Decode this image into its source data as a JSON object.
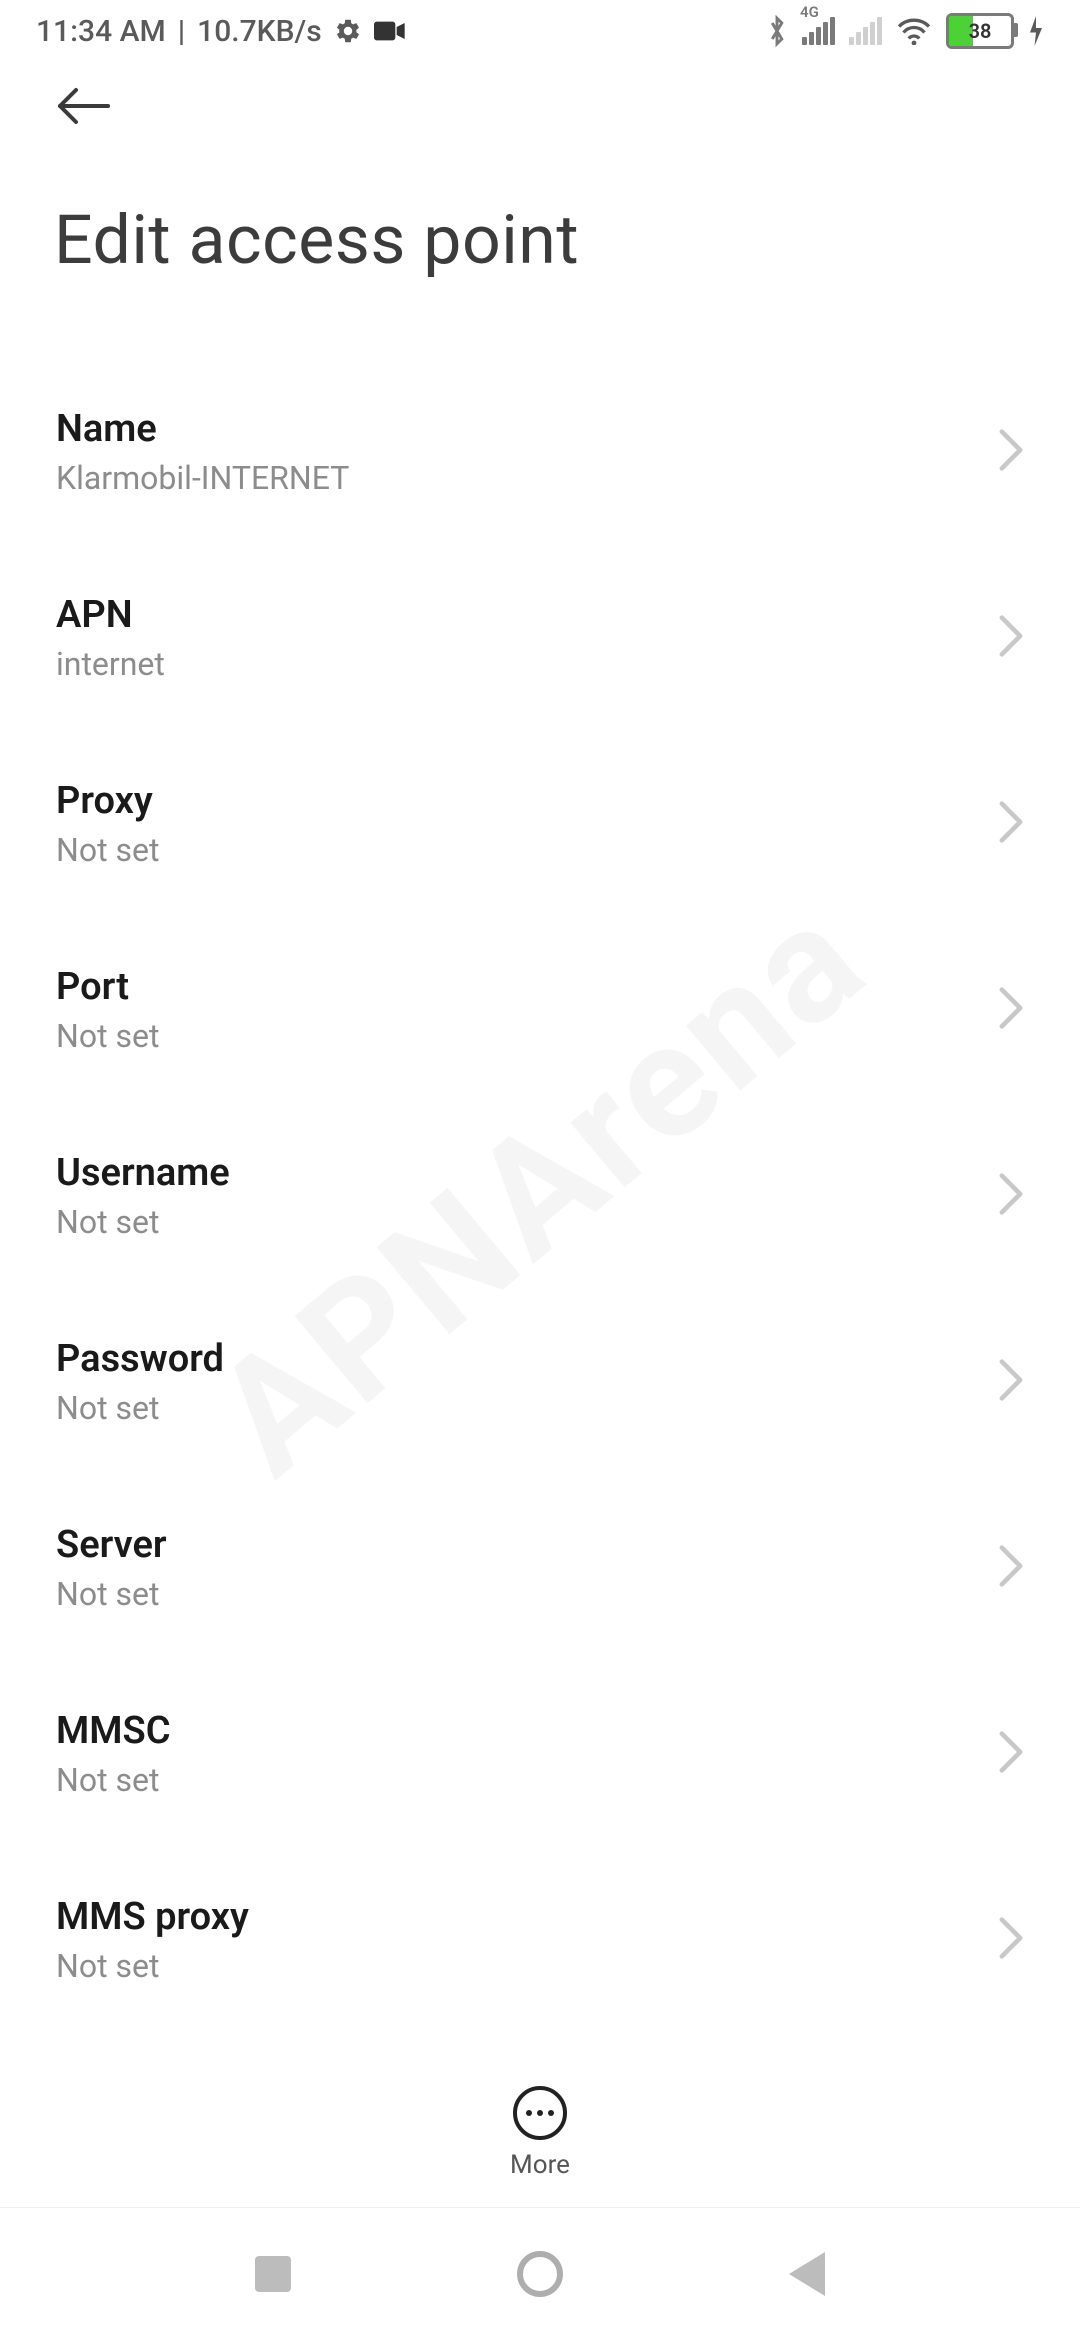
{
  "status": {
    "time": "11:34 AM",
    "net_speed": "10.7KB/s",
    "battery_percent": 38,
    "battery_text": "38",
    "network_type": "4G"
  },
  "header": {
    "title": "Edit access point"
  },
  "fields": [
    {
      "label": "Name",
      "value": "Klarmobil-INTERNET"
    },
    {
      "label": "APN",
      "value": "internet"
    },
    {
      "label": "Proxy",
      "value": "Not set"
    },
    {
      "label": "Port",
      "value": "Not set"
    },
    {
      "label": "Username",
      "value": "Not set"
    },
    {
      "label": "Password",
      "value": "Not set"
    },
    {
      "label": "Server",
      "value": "Not set"
    },
    {
      "label": "MMSC",
      "value": "Not set"
    },
    {
      "label": "MMS proxy",
      "value": "Not set"
    }
  ],
  "footer": {
    "more_label": "More"
  },
  "watermark": "APNArena"
}
